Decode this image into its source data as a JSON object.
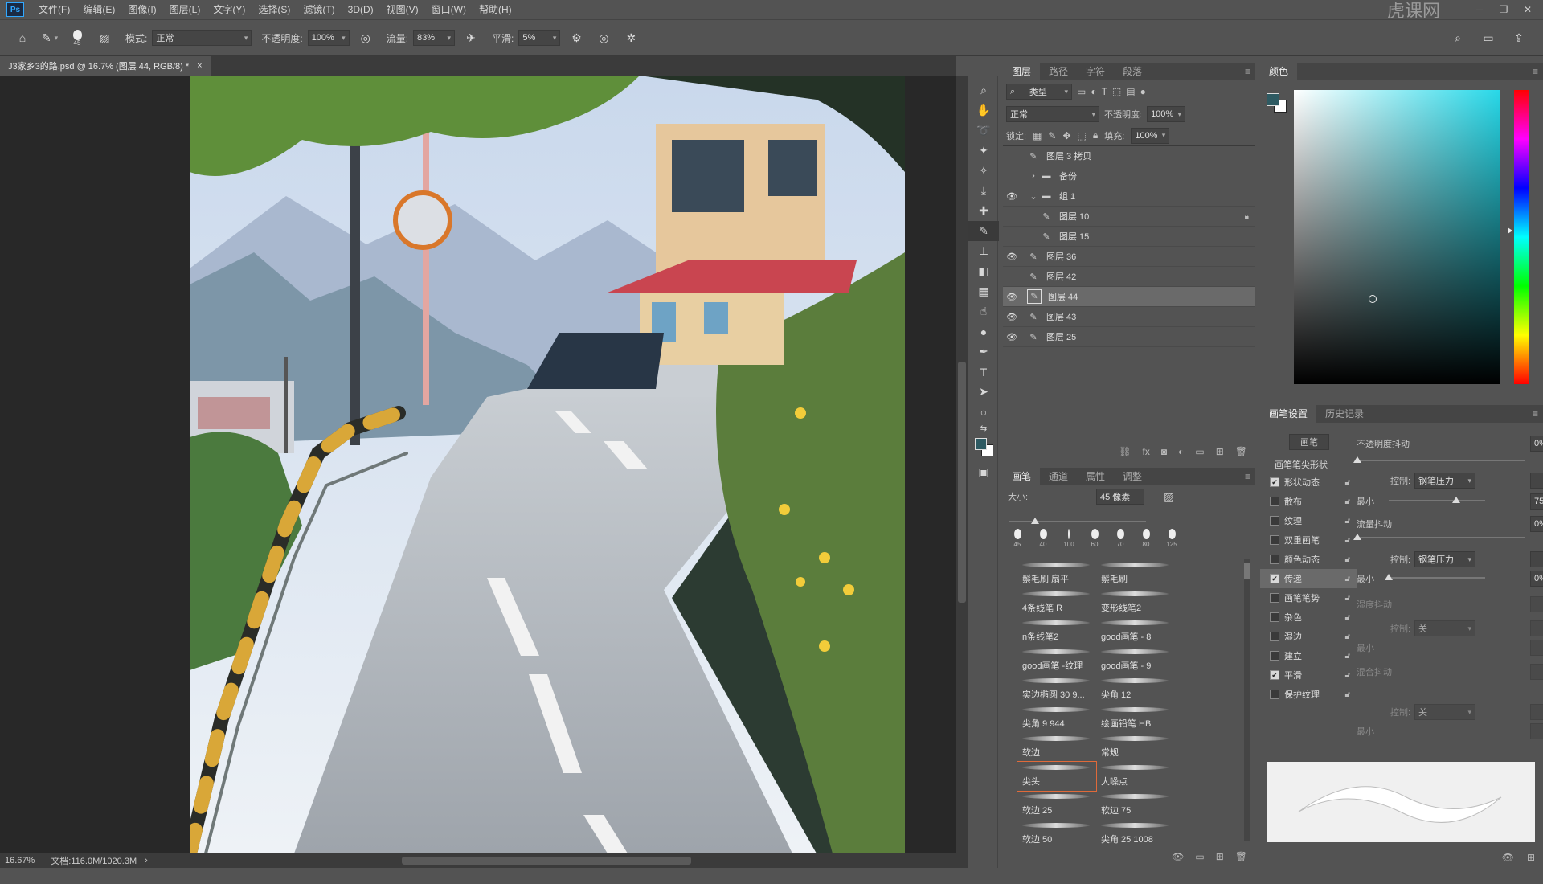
{
  "app": {
    "logo": "Ps"
  },
  "menu": [
    "文件(F)",
    "编辑(E)",
    "图像(I)",
    "图层(L)",
    "文字(Y)",
    "选择(S)",
    "滤镜(T)",
    "3D(D)",
    "视图(V)",
    "窗口(W)",
    "帮助(H)"
  ],
  "watermark": "虎课网",
  "options": {
    "brush_size_preview": "45",
    "mode_label": "模式:",
    "mode_value": "正常",
    "opacity_label": "不透明度:",
    "opacity_value": "100%",
    "flow_label": "流量:",
    "flow_value": "83%",
    "smooth_label": "平滑:",
    "smooth_value": "5%"
  },
  "document": {
    "tab_title": "J3家乡3的路.psd @ 16.7% (图层 44, RGB/8) *",
    "close": "×"
  },
  "status": {
    "zoom": "16.67%",
    "doc_info": "文档:116.0M/1020.3M"
  },
  "layers_panel": {
    "tabs": [
      "图层",
      "路径",
      "字符",
      "段落"
    ],
    "filter_label": "类型",
    "blend_mode": "正常",
    "opacity_label": "不透明度:",
    "opacity_value": "100%",
    "lock_label": "锁定:",
    "fill_label": "填充:",
    "fill_value": "100%",
    "layers": [
      {
        "name": "图层 3 拷贝",
        "visible": false,
        "kind": "brush",
        "indent": 0,
        "locked": false,
        "selected": false
      },
      {
        "name": "备份",
        "visible": false,
        "kind": "group-closed",
        "indent": 0,
        "locked": false,
        "selected": false
      },
      {
        "name": "组 1",
        "visible": true,
        "kind": "group-open",
        "indent": 0,
        "locked": false,
        "selected": false
      },
      {
        "name": "图层 10",
        "visible": false,
        "kind": "brush",
        "indent": 1,
        "locked": true,
        "selected": false
      },
      {
        "name": "图层 15",
        "visible": false,
        "kind": "brush",
        "indent": 1,
        "locked": false,
        "selected": false
      },
      {
        "name": "图层 36",
        "visible": true,
        "kind": "brush",
        "indent": 0,
        "locked": false,
        "selected": false
      },
      {
        "name": "图层 42",
        "visible": false,
        "kind": "brush",
        "indent": 0,
        "locked": false,
        "selected": false
      },
      {
        "name": "图层 44",
        "visible": true,
        "kind": "brush",
        "indent": 0,
        "locked": false,
        "selected": true
      },
      {
        "name": "图层 43",
        "visible": true,
        "kind": "brush",
        "indent": 0,
        "locked": false,
        "selected": false
      },
      {
        "name": "图层 25",
        "visible": true,
        "kind": "brush",
        "indent": 0,
        "locked": false,
        "selected": false
      }
    ]
  },
  "color_panel": {
    "tab": "颜色",
    "fg": "#2e5a62",
    "bg": "#ffffff"
  },
  "brushes_panel": {
    "tabs": [
      "画笔",
      "通道",
      "属性",
      "调整"
    ],
    "size_label": "大小:",
    "size_value": "45 像素",
    "presets": [
      "45",
      "40",
      "100",
      "60",
      "70",
      "80",
      "125"
    ],
    "brushes": [
      "鬃毛刷 扇平",
      "鬃毛刷",
      "4条线笔 R",
      "变形线笔2",
      "n条线笔2",
      "good画笔 - 8",
      "good画笔 -纹理",
      "good画笔 - 9",
      "实边椭圆 30 9...",
      "尖角 12",
      "尖角 9 944",
      "绘画铅笔 HB",
      "软边",
      "常规",
      "尖头",
      "大噪点",
      "软边 25",
      "软边 75",
      "软边 50",
      "尖角 25 1008"
    ],
    "selected_index": 14
  },
  "brush_settings": {
    "tabs": [
      "画笔设置",
      "历史记录"
    ],
    "button": "画笔",
    "tip_shape": "画笔笔尖形状",
    "options": [
      {
        "label": "形状动态",
        "checked": true
      },
      {
        "label": "散布",
        "checked": false
      },
      {
        "label": "纹理",
        "checked": false
      },
      {
        "label": "双重画笔",
        "checked": false
      },
      {
        "label": "颜色动态",
        "checked": false
      },
      {
        "label": "传递",
        "checked": true
      },
      {
        "label": "画笔笔势",
        "checked": false
      },
      {
        "label": "杂色",
        "checked": false
      },
      {
        "label": "湿边",
        "checked": false
      },
      {
        "label": "建立",
        "checked": false
      },
      {
        "label": "平滑",
        "checked": true
      },
      {
        "label": "保护纹理",
        "checked": false
      }
    ],
    "opacity_jitter_label": "不透明度抖动",
    "opacity_jitter_value": "0%",
    "control_label": "控制:",
    "control_value": "钢笔压力",
    "min_label": "最小",
    "min_value": "75%",
    "flow_jitter_label": "流量抖动",
    "flow_jitter_value": "0%",
    "control2_value": "钢笔压力",
    "min2_value": "0%",
    "wet_jitter_label": "湿度抖动",
    "control3_value": "关",
    "mix_jitter_label": "混合抖动",
    "control4_value": "关",
    "min_label2": "最小"
  }
}
